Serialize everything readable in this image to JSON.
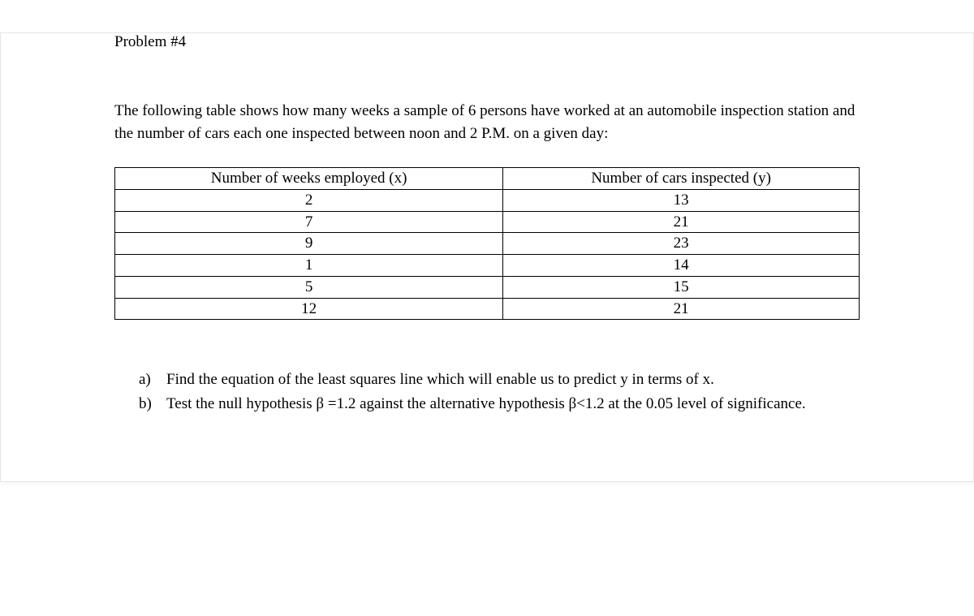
{
  "problem_title": "Problem #4",
  "intro": "The following table shows how many weeks a sample of 6 persons have worked at an automobile inspection station and the number of cars each one inspected between noon and 2 P.M. on a given day:",
  "table": {
    "headers": {
      "x": "Number of weeks employed (x)",
      "y": "Number of cars inspected (y)"
    },
    "rows": [
      {
        "x": "2",
        "y": "13"
      },
      {
        "x": "7",
        "y": "21"
      },
      {
        "x": "9",
        "y": "23"
      },
      {
        "x": "1",
        "y": "14"
      },
      {
        "x": "5",
        "y": "15"
      },
      {
        "x": "12",
        "y": "21"
      }
    ]
  },
  "questions": {
    "a": {
      "marker": "a)",
      "text": "Find the equation of the least squares line which will enable us to predict y in terms of x."
    },
    "b": {
      "marker": "b)",
      "text": "Test the null hypothesis β =1.2 against the alternative hypothesis β<1.2 at the 0.05 level of significance."
    }
  }
}
